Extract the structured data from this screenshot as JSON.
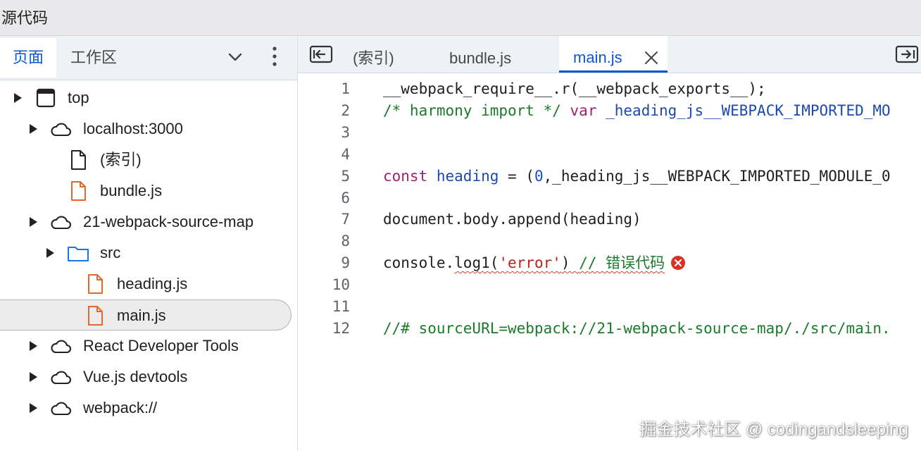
{
  "window": {
    "title": "源代码"
  },
  "left_panel": {
    "tabs": [
      {
        "label": "页面",
        "active": true
      },
      {
        "label": "工作区",
        "active": false
      }
    ],
    "more_options_icon": "chevron-down-icon",
    "menu_icon": "kebab-menu-icon",
    "tree": [
      {
        "label": "top",
        "icon": "frame-icon",
        "expandable": true
      },
      {
        "label": "localhost:3000",
        "icon": "cloud-icon",
        "expandable": true
      },
      {
        "label": "(索引)",
        "icon": "file-icon",
        "expandable": false
      },
      {
        "label": "bundle.js",
        "icon": "js-file-icon",
        "expandable": false
      },
      {
        "label": "21-webpack-source-map",
        "icon": "cloud-icon",
        "expandable": true
      },
      {
        "label": "src",
        "icon": "folder-icon",
        "expandable": true
      },
      {
        "label": "heading.js",
        "icon": "js-file-icon",
        "expandable": false
      },
      {
        "label": "main.js",
        "icon": "js-file-icon",
        "expandable": false,
        "selected": true
      },
      {
        "label": "React Developer Tools",
        "icon": "cloud-icon",
        "expandable": true
      },
      {
        "label": "Vue.js devtools",
        "icon": "cloud-icon",
        "expandable": true
      },
      {
        "label": "webpack://",
        "icon": "cloud-icon",
        "expandable": true
      }
    ]
  },
  "editor": {
    "tabs": [
      {
        "label": "(索引)"
      },
      {
        "label": "bundle.js"
      },
      {
        "label": "main.js",
        "active": true,
        "closable": true
      }
    ],
    "lines": [
      {
        "num": "1",
        "segments": [
          {
            "t": "__webpack_require__.r(__webpack_exports__);",
            "c": "plain"
          }
        ]
      },
      {
        "num": "2",
        "segments": [
          {
            "t": "/* harmony import */",
            "c": "comment"
          },
          {
            "t": " ",
            "c": "plain"
          },
          {
            "t": "var",
            "c": "keyword"
          },
          {
            "t": " ",
            "c": "plain"
          },
          {
            "t": "_heading_js__WEBPACK_IMPORTED_MO",
            "c": "var"
          }
        ]
      },
      {
        "num": "3",
        "segments": []
      },
      {
        "num": "4",
        "segments": []
      },
      {
        "num": "5",
        "segments": [
          {
            "t": "const",
            "c": "keyword"
          },
          {
            "t": " ",
            "c": "plain"
          },
          {
            "t": "heading",
            "c": "var"
          },
          {
            "t": " = (",
            "c": "plain"
          },
          {
            "t": "0",
            "c": "number"
          },
          {
            "t": ",_heading_js__WEBPACK_IMPORTED_MODULE_0",
            "c": "plain"
          }
        ]
      },
      {
        "num": "6",
        "segments": []
      },
      {
        "num": "7",
        "segments": [
          {
            "t": "document.body.append(heading)",
            "c": "plain"
          }
        ]
      },
      {
        "num": "8",
        "segments": []
      },
      {
        "num": "9",
        "segments": [
          {
            "t": "console.",
            "c": "plain"
          },
          {
            "t": "log1(",
            "c": "plain",
            "squiggle": true
          },
          {
            "t": "'error'",
            "c": "string",
            "squiggle": true
          },
          {
            "t": ") ",
            "c": "plain",
            "squiggle": true
          },
          {
            "t": "// 错误代码",
            "c": "comment",
            "squiggle": true
          }
        ],
        "error": true
      },
      {
        "num": "10",
        "segments": []
      },
      {
        "num": "11",
        "segments": []
      },
      {
        "num": "12",
        "segments": [
          {
            "t": "//# sourceURL=webpack://21-webpack-source-map/./src/main.",
            "c": "comment"
          }
        ]
      }
    ]
  },
  "watermark": "掘金技术社区 @ codingandsleeping",
  "colors": {
    "accent": "#0b57d0",
    "keyword": "#a1216f",
    "comment": "#1b7a2b",
    "variable": "#1c4aad",
    "string": "#b3261e",
    "error": "#d93025",
    "js_file": "#e0672f",
    "folder": "#1a73e8"
  }
}
